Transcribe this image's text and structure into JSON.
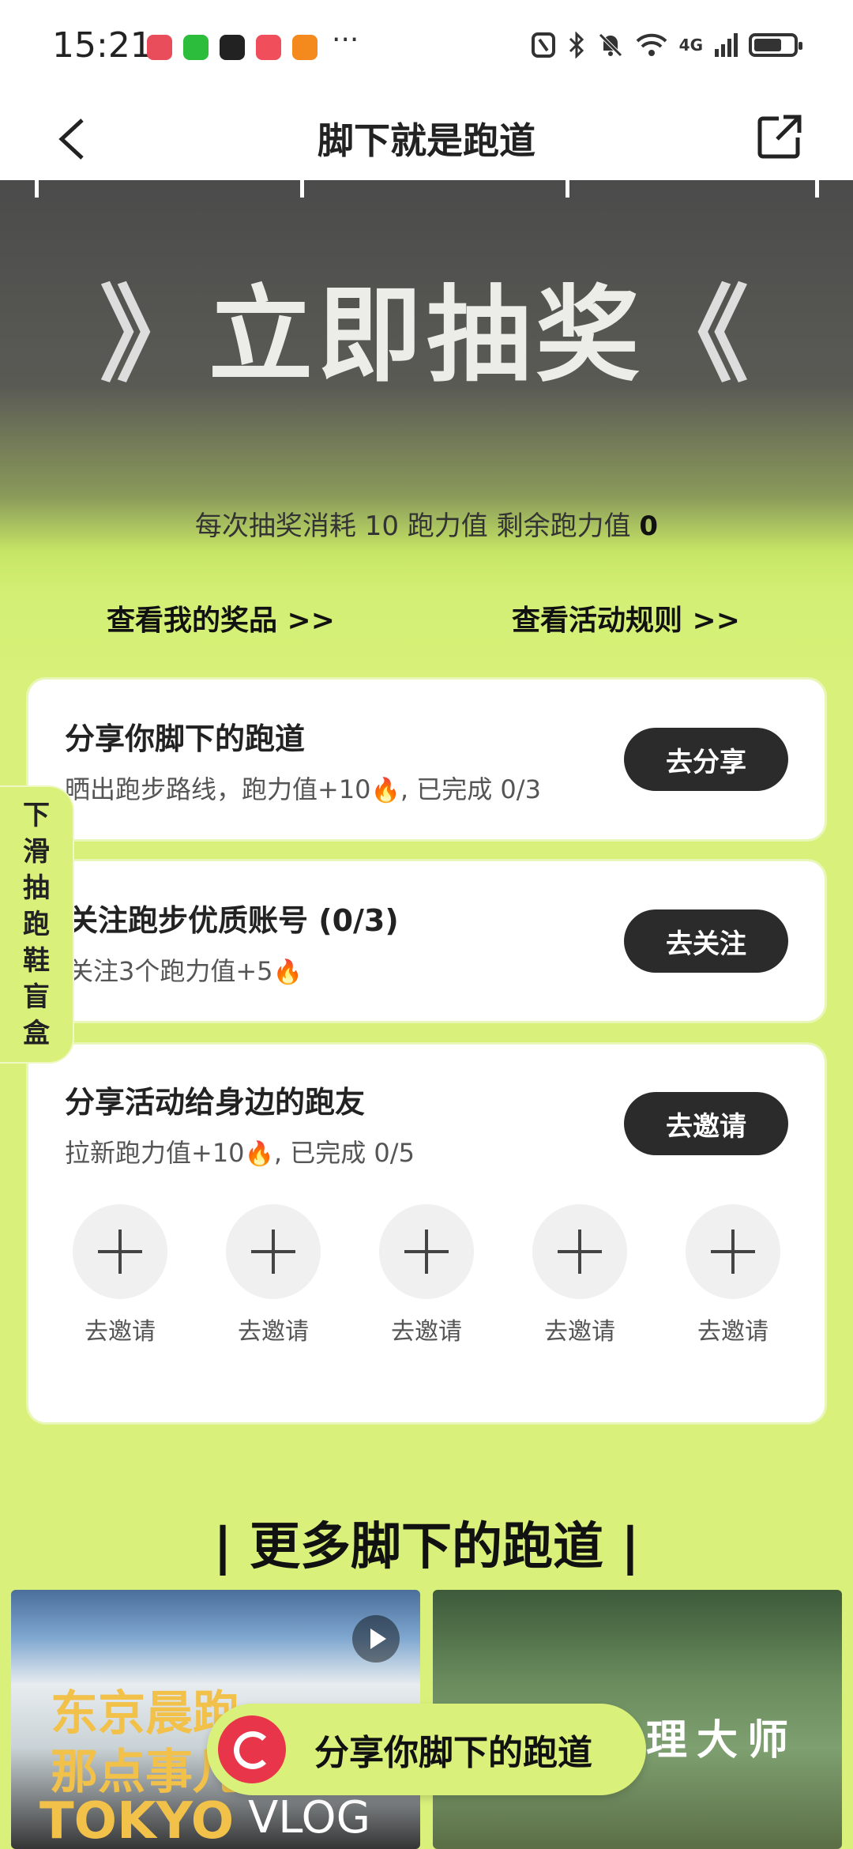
{
  "status_bar": {
    "time": "15:21",
    "more": "···",
    "network": "4G"
  },
  "nav": {
    "title": "脚下就是跑道"
  },
  "hero": {
    "title": "立即抽奖",
    "left_deco": "》",
    "right_deco": "《",
    "consume_prefix": "每次抽奖消耗 10 跑力值 剩余跑力值 ",
    "remaining": "0",
    "link_prizes": "查看我的奖品 >>",
    "link_rules": "查看活动规则 >>"
  },
  "tasks": [
    {
      "title": "分享你脚下的跑道",
      "sub": "晒出跑步路线，跑力值+10",
      "progress": ", 已完成 0/3",
      "button": "去分享"
    },
    {
      "title": "关注跑步优质账号 (0/3)",
      "sub": "关注3个跑力值+5",
      "progress": "",
      "button": "去关注"
    },
    {
      "title": "分享活动给身边的跑友",
      "sub": "拉新跑力值+10",
      "progress": ", 已完成 0/5",
      "button": "去邀请"
    }
  ],
  "invite_slots": [
    "去邀请",
    "去邀请",
    "去邀请",
    "去邀请",
    "去邀请"
  ],
  "side_tab": [
    "下",
    "滑",
    "抽",
    "跑",
    "鞋",
    "盲",
    "盒"
  ],
  "more_section": {
    "title": "| 更多脚下的跑道 |"
  },
  "thumbs": {
    "left": {
      "line1": "东京晨跑",
      "line2": "那点事儿",
      "line3": "TOKYO",
      "vlog": "VLOG"
    },
    "right": {
      "text": "理大师"
    }
  },
  "float_share": {
    "label": "分享你脚下的跑道"
  },
  "colors": {
    "accent": "#d9f07a",
    "button": "#2b2b2b"
  }
}
